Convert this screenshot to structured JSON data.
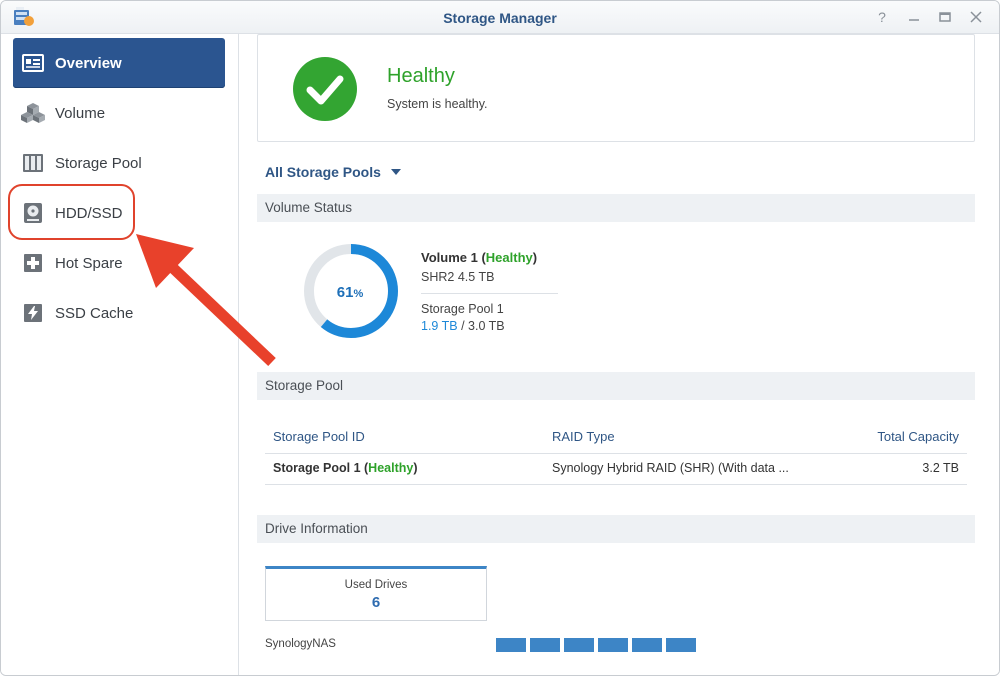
{
  "window": {
    "title": "Storage Manager"
  },
  "sidebar": {
    "items": [
      {
        "label": "Overview",
        "icon": "overview-icon",
        "active": true
      },
      {
        "label": "Volume",
        "icon": "volume-icon"
      },
      {
        "label": "Storage Pool",
        "icon": "storage-pool-icon"
      },
      {
        "label": "HDD/SSD",
        "icon": "hdd-icon"
      },
      {
        "label": "Hot Spare",
        "icon": "hot-spare-icon"
      },
      {
        "label": "SSD Cache",
        "icon": "ssd-cache-icon"
      }
    ]
  },
  "health": {
    "status": "Healthy",
    "message": "System is healthy.",
    "color": "#2ea22a"
  },
  "pool_selector": {
    "label": "All Storage Pools"
  },
  "volume_status": {
    "section_title": "Volume Status",
    "usage_percent": 61,
    "usage_label": "61",
    "usage_unit": "%",
    "volume_name": "Volume 1",
    "volume_state": "Healthy",
    "raid_size": "SHR2 4.5 TB",
    "pool_name": "Storage Pool 1",
    "used": "1.9 TB",
    "total_sep": " / 3.0 TB"
  },
  "storage_pool": {
    "section_title": "Storage Pool",
    "columns": [
      "Storage Pool ID",
      "RAID Type",
      "Total Capacity"
    ],
    "rows": [
      {
        "id": "Storage Pool 1",
        "state": "Healthy",
        "raid": "Synology Hybrid RAID (SHR) (With data ...",
        "capacity": "3.2 TB"
      }
    ]
  },
  "drive_info": {
    "section_title": "Drive Information",
    "used_drives_label": "Used Drives",
    "used_drives_count": "6",
    "nas_name": "SynologyNAS",
    "bay_count": 6
  },
  "colors": {
    "accent": "#2b5590",
    "healthy": "#2ea22a",
    "usage": "#1d88d8",
    "annotation": "#e0432c"
  }
}
